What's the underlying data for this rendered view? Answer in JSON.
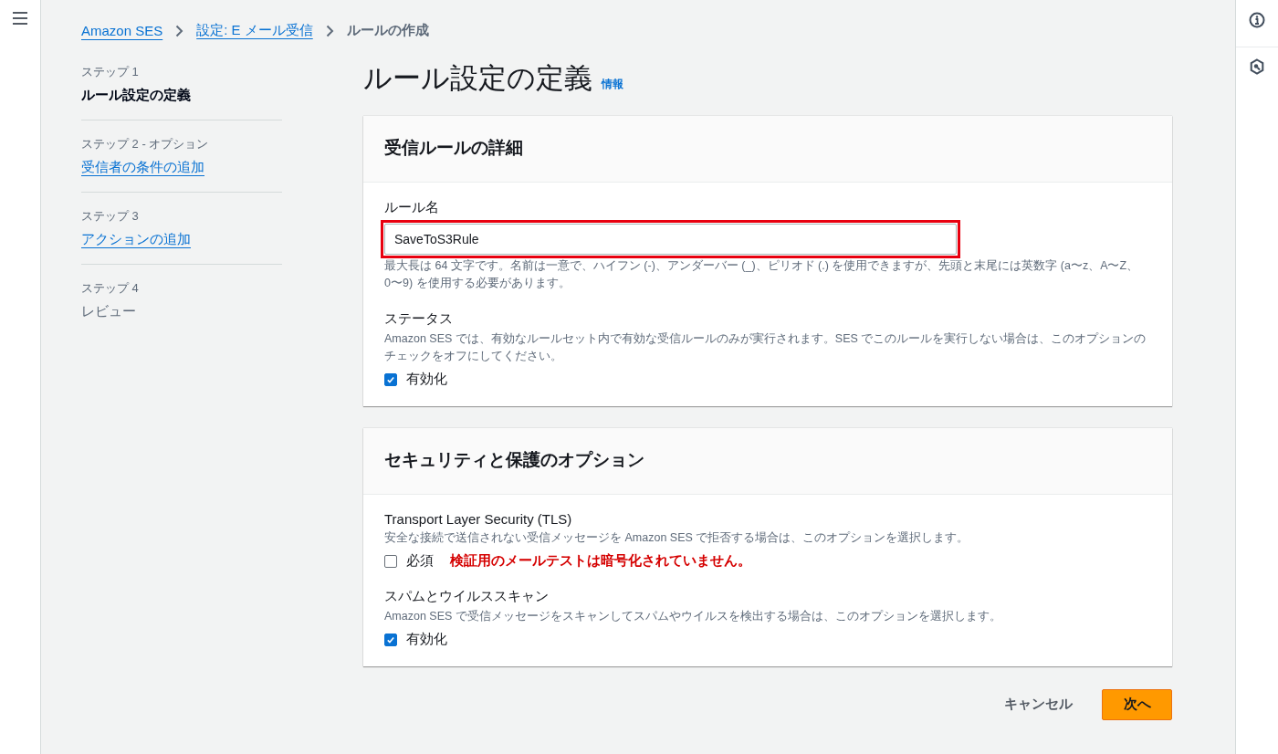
{
  "breadcrumbs": [
    {
      "label": "Amazon SES",
      "link": true
    },
    {
      "label": "設定: E メール受信",
      "link": true
    },
    {
      "label": "ルールの作成",
      "link": false
    }
  ],
  "steps": [
    {
      "step": "ステップ 1",
      "title": "ルール設定の定義",
      "selected": true,
      "disabled": false
    },
    {
      "step": "ステップ 2 - オプション",
      "title": "受信者の条件の追加",
      "selected": false,
      "disabled": false
    },
    {
      "step": "ステップ 3",
      "title": "アクションの追加",
      "selected": false,
      "disabled": false
    },
    {
      "step": "ステップ 4",
      "title": "レビュー",
      "selected": false,
      "disabled": true
    }
  ],
  "page": {
    "title": "ルール設定の定義",
    "info": "情報"
  },
  "panels": [
    {
      "title": "受信ルールの詳細",
      "fields": [
        {
          "kind": "text",
          "label": "ルール名",
          "value": "SaveToS3Rule",
          "highlighted": true,
          "hint": "最大長は 64 文字です。名前は一意で、ハイフン (-)、アンダーバー (_)、ピリオド (.) を使用できますが、先頭と末尾には英数字 (a〜z、A〜Z、0〜9) を使用する必要があります。"
        },
        {
          "kind": "checkbox",
          "label": "ステータス",
          "description": "Amazon SES では、有効なルールセット内で有効な受信ルールのみが実行されます。SES でこのルールを実行しない場合は、このオプションのチェックをオフにしてください。",
          "option": "有効化",
          "checked": true
        }
      ]
    },
    {
      "title": "セキュリティと保護のオプション",
      "fields": [
        {
          "kind": "checkbox",
          "label": "Transport Layer Security (TLS)",
          "description": "安全な接続で送信されない受信メッセージを Amazon SES で拒否する場合は、このオプションを選択します。",
          "option": "必須",
          "checked": false,
          "note": "検証用のメールテストは暗号化されていません。"
        },
        {
          "kind": "checkbox",
          "label": "スパムとウイルススキャン",
          "description": "Amazon SES で受信メッセージをスキャンしてスパムやウイルスを検出する場合は、このオプションを選択します。",
          "option": "有効化",
          "checked": true
        }
      ]
    }
  ],
  "buttons": [
    {
      "label": "キャンセル",
      "kind": "link"
    },
    {
      "label": "次へ",
      "kind": "primary"
    }
  ]
}
